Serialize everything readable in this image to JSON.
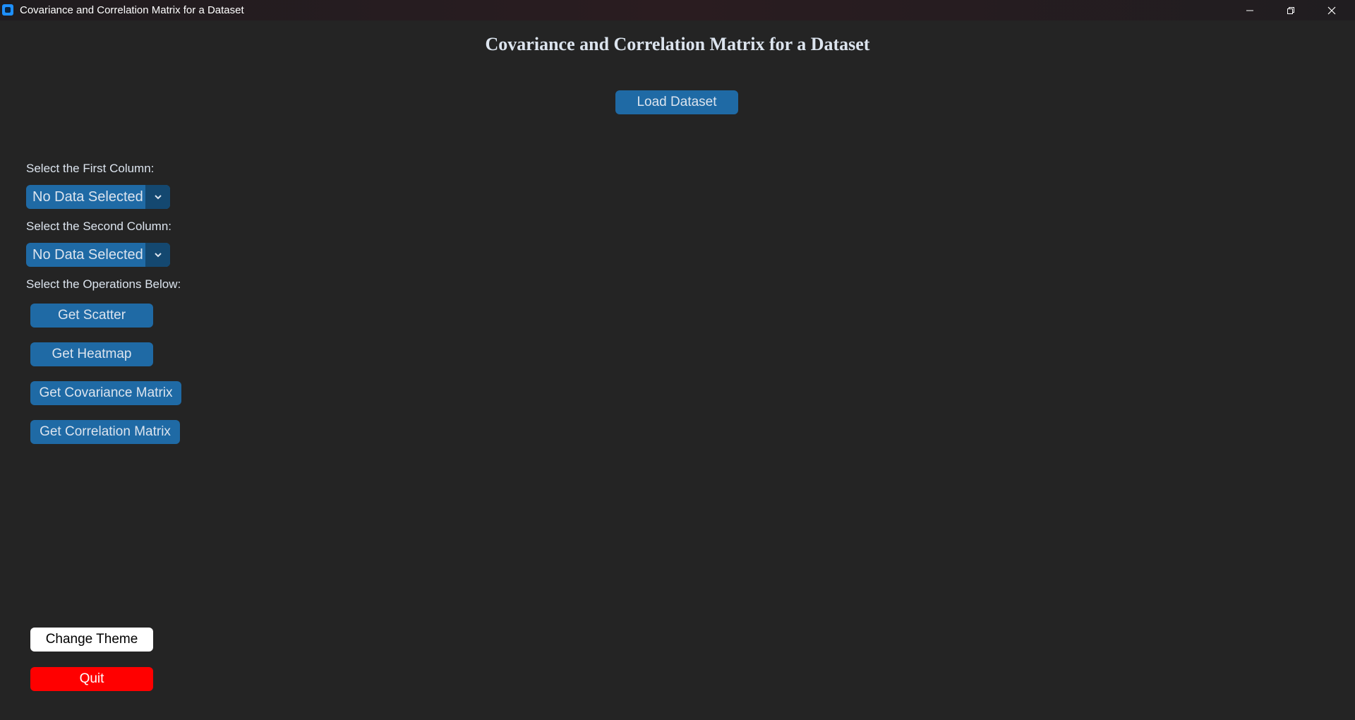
{
  "window": {
    "title": "Covariance and Correlation Matrix for a Dataset",
    "icons": {
      "app": "app-icon",
      "minimize": "minimize-icon",
      "maximize": "restore-icon",
      "close": "close-icon"
    }
  },
  "main": {
    "title": "Covariance and Correlation Matrix for a Dataset",
    "load_button": "Load Dataset"
  },
  "controls": {
    "first_column_label": "Select the First Column:",
    "first_column_value": "No Data Selected",
    "second_column_label": "Select the Second Column:",
    "second_column_value": "No Data Selected",
    "operations_label": "Select the Operations Below:",
    "operations": {
      "scatter": "Get Scatter",
      "heatmap": "Get Heatmap",
      "covariance": "Get Covariance Matrix",
      "correlation": "Get Correlation Matrix"
    }
  },
  "footer": {
    "change_theme": "Change Theme",
    "quit": "Quit"
  },
  "colors": {
    "background": "#242424",
    "button_accent": "#1f6aa5",
    "dropdown_arrow_bg": "#144870",
    "theme_button_bg": "#ffffff",
    "quit_button_bg": "#ff0000",
    "text": "#dce4ee"
  }
}
